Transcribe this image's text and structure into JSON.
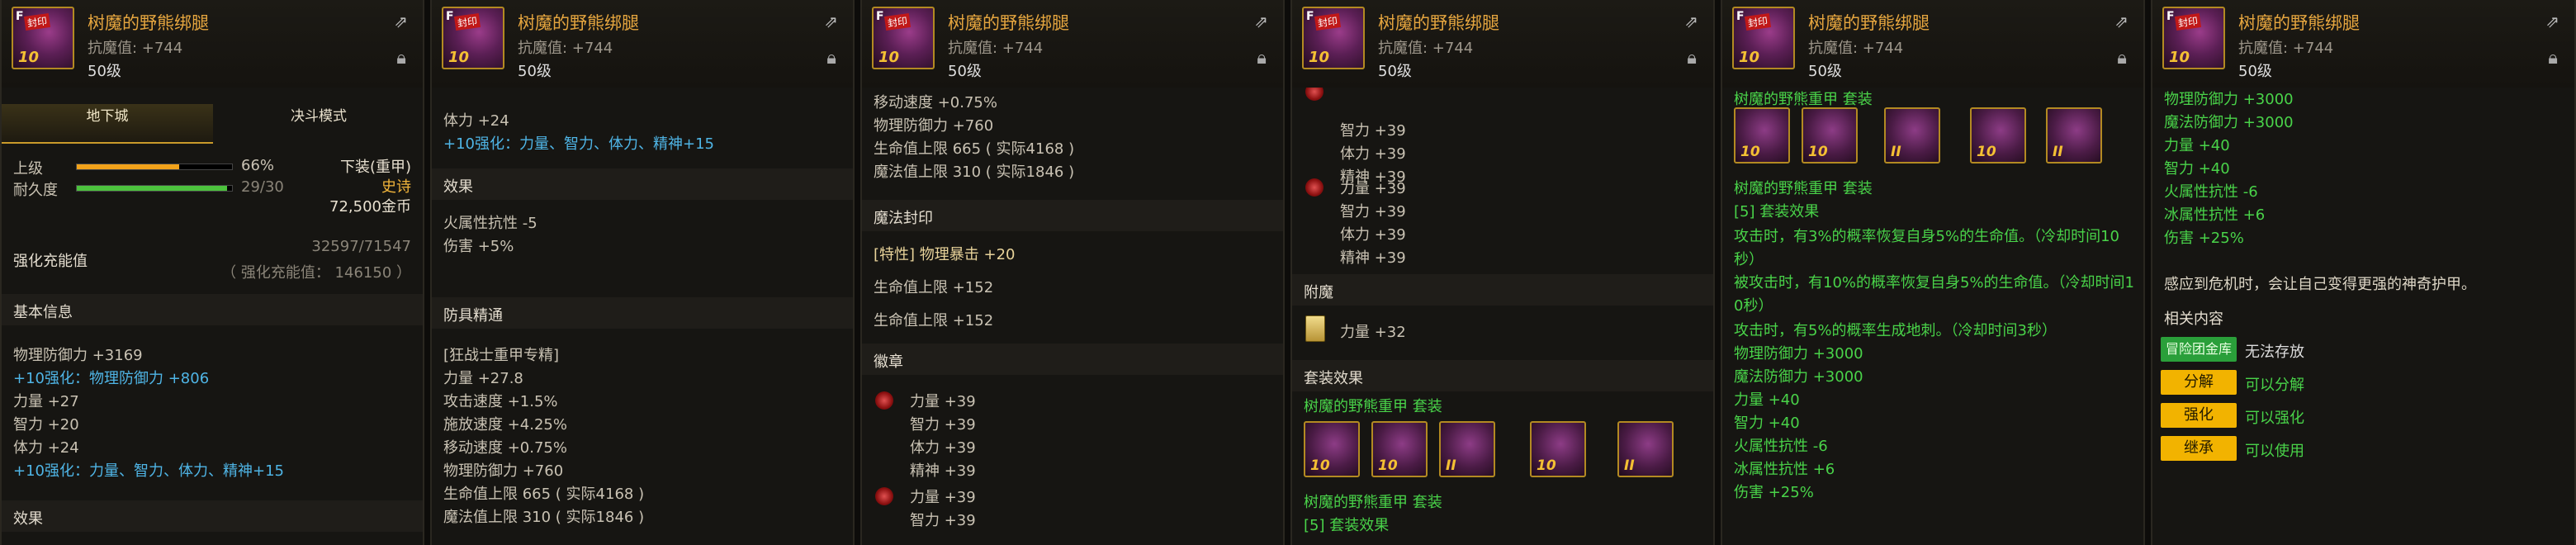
{
  "common": {
    "item_name": "树魔的野熊绑腿",
    "resistance": "抗魔值: +744",
    "level": "50级",
    "icon_grade": "F",
    "icon_level": "10",
    "icon_seal": "封印"
  },
  "panel1": {
    "tabs": [
      "地下城",
      "决斗模式"
    ],
    "grade_label": "上级",
    "grade_pct": "66%",
    "grade_fill": 0.66,
    "durability_label": "耐久度",
    "durability_value": "29/30",
    "durability_fill": 0.967,
    "slot_type": "下装(重甲)",
    "rarity": "史诗",
    "price": "72,500金币",
    "enhance_title": "强化充能值",
    "enhance_value": "32597/71547",
    "enhance_sub": "（ 强化充能值： 146150 ）",
    "basic_title": "基本信息",
    "lines": [
      {
        "t": "物理防御力 +3169",
        "c": ""
      },
      {
        "t": "+10强化：物理防御力 +806",
        "c": "blue"
      },
      {
        "t": "力量 +27",
        "c": ""
      },
      {
        "t": "智力 +20",
        "c": ""
      },
      {
        "t": "体力 +24",
        "c": ""
      },
      {
        "t": "+10强化：力量、智力、体力、精神+15",
        "c": "blue"
      }
    ],
    "effects_title": "效果"
  },
  "panel2": {
    "lines_top": [
      {
        "t": "体力 +24",
        "c": ""
      },
      {
        "t": "+10强化：力量、智力、体力、精神+15",
        "c": "blue"
      }
    ],
    "effects_title": "效果",
    "effects": [
      "火属性抗性 -5",
      "伤害 +5%"
    ],
    "tune_title": "防具精通",
    "tune_lines": [
      "[狂战士重甲专精]",
      "力量 +27.8",
      "攻击速度 +1.5%",
      "施放速度 +4.25%",
      "移动速度 +0.75%",
      "物理防御力 +760",
      "生命值上限 665 ( 实际4168 )",
      "魔法值上限 310 ( 实际1846 )"
    ]
  },
  "panel3": {
    "lines_top": [
      "移动速度 +0.75%",
      "物理防御力 +760",
      "生命值上限 665 ( 实际4168 )",
      "魔法值上限 310 ( 实际1846 )"
    ],
    "seal_title": "魔法封印",
    "seal_lines": [
      "[特性] 物理暴击 +20",
      "生命值上限 +152",
      "生命值上限 +152"
    ],
    "emblem_title": "徽章",
    "emblem_group1": [
      "力量 +39",
      "智力 +39",
      "体力 +39",
      "精神 +39"
    ],
    "emblem_group2": [
      "力量 +39",
      "智力 +39"
    ]
  },
  "panel4": {
    "emblem_group1": [
      "智力 +39",
      "体力 +39",
      "精神 +39"
    ],
    "emblem_group2": [
      "力量 +39",
      "智力 +39",
      "体力 +39",
      "精神 +39"
    ],
    "enchant_title": "附魔",
    "enchant_value": "力量 +32",
    "set_title": "套装效果",
    "set_name": "树魔的野熊重甲  套装",
    "set_levels": [
      "10",
      "10",
      "II",
      "10",
      "II"
    ],
    "set_name2": "树魔的野熊重甲  套装",
    "set_count": "[5] 套装效果"
  },
  "panel5": {
    "set_name_top": "树魔的野熊重甲  套装",
    "set_levels": [
      "10",
      "10",
      "II",
      "10",
      "II"
    ],
    "set_name": "树魔的野熊重甲  套装",
    "set_count": "[5] 套装效果",
    "set_lines": [
      "攻击时，有3%的概率恢复自身5%的生命值。（冷却时间10",
      "秒）",
      "被攻击时，有10%的概率恢复自身5%的生命值。（冷却时间1",
      "0秒）",
      "攻击时，有5%的概率生成地刺。（冷却时间3秒）",
      "物理防御力 +3000",
      "魔法防御力 +3000",
      "力量 +40",
      "智力 +40",
      "火属性抗性 -6",
      "冰属性抗性 +6",
      "伤害 +25%"
    ]
  },
  "panel6": {
    "lines": [
      "物理防御力 +3000",
      "魔法防御力 +3000",
      "力量 +40",
      "智力 +40",
      "火属性抗性 -6",
      "冰属性抗性 +6",
      "伤害 +25%"
    ],
    "flavor": "感应到危机时，会让自己变得更强的神奇护甲。",
    "related_title": "相关内容",
    "storage_badge": "冒险团金库",
    "storage_text": "无法存放",
    "actions": [
      {
        "label": "分解",
        "status": "可以分解"
      },
      {
        "label": "强化",
        "status": "可以强化"
      },
      {
        "label": "继承",
        "status": "可以使用"
      }
    ]
  }
}
